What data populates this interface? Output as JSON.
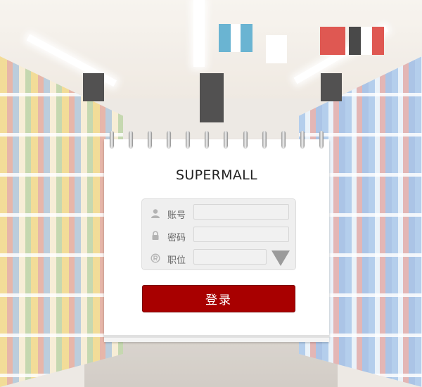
{
  "app": {
    "title": "SUPERMALL"
  },
  "form": {
    "account": {
      "label": "账号",
      "value": "",
      "icon": "user-icon"
    },
    "password": {
      "label": "密码",
      "value": "",
      "icon": "lock-icon"
    },
    "role": {
      "label": "职位",
      "value": "",
      "icon": "registered-icon",
      "dropdown_icon": "triangle-down-icon"
    }
  },
  "login": {
    "label": "登录",
    "color": "#a80000"
  },
  "theme": {
    "card_bg": "#ffffff",
    "form_bg": "#efefef"
  }
}
